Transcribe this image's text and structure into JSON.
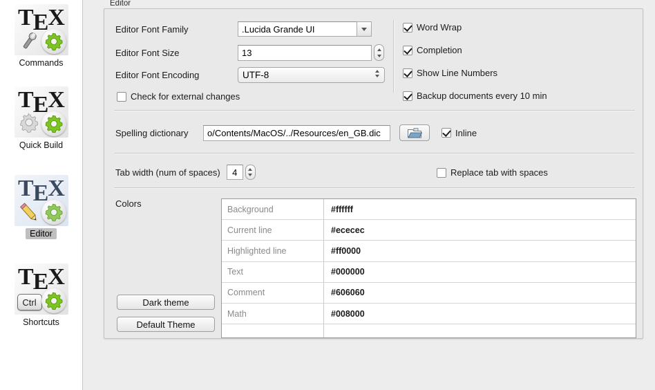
{
  "sidebar": {
    "items": [
      {
        "label": "Commands",
        "icon": "tex-wrench-gear-icon",
        "selected": false
      },
      {
        "label": "Quick Build",
        "icon": "tex-gears-icon",
        "selected": false
      },
      {
        "label": "Editor",
        "icon": "tex-pencil-gear-icon",
        "selected": true
      },
      {
        "label": "Shortcuts",
        "icon": "tex-ctrl-gear-icon",
        "selected": false
      }
    ],
    "tex_prefix": "T",
    "tex_middle": "E",
    "tex_suffix": "X",
    "ctrl_label": "Ctrl"
  },
  "panel": {
    "title": "Editor",
    "font_family": {
      "label": "Editor Font Family",
      "value": ".Lucida Grande UI"
    },
    "font_size": {
      "label": "Editor Font Size",
      "value": "13"
    },
    "font_encoding": {
      "label": "Editor Font Encoding",
      "value": "UTF-8"
    },
    "check_external": {
      "label": "Check for external changes",
      "checked": false
    },
    "options": [
      {
        "label": "Word Wrap",
        "checked": true
      },
      {
        "label": "Completion",
        "checked": true
      },
      {
        "label": "Show Line Numbers",
        "checked": true
      },
      {
        "label": "Backup documents every 10 min",
        "checked": true
      }
    ],
    "spelling": {
      "label": "Spelling dictionary",
      "value": "o/Contents/MacOS/../Resources/en_GB.dic",
      "browse_icon": "open-folder-icon",
      "inline": {
        "label": "Inline",
        "checked": true
      }
    },
    "tab_width": {
      "label": "Tab width (num of spaces)",
      "value": "4"
    },
    "replace_tab": {
      "label": "Replace tab with spaces",
      "checked": false
    },
    "colors": {
      "label": "Colors",
      "dark_theme_button": "Dark theme",
      "default_theme_button": "Default Theme",
      "rows": [
        {
          "name": "Background",
          "value": "#ffffff"
        },
        {
          "name": "Current line",
          "value": "#ececec"
        },
        {
          "name": "Highlighted line",
          "value": "#ff0000"
        },
        {
          "name": "Text",
          "value": "#000000"
        },
        {
          "name": "Comment",
          "value": "#606060"
        },
        {
          "name": "Math",
          "value": "#008000"
        },
        {
          "name": "",
          "value": ""
        }
      ]
    }
  }
}
